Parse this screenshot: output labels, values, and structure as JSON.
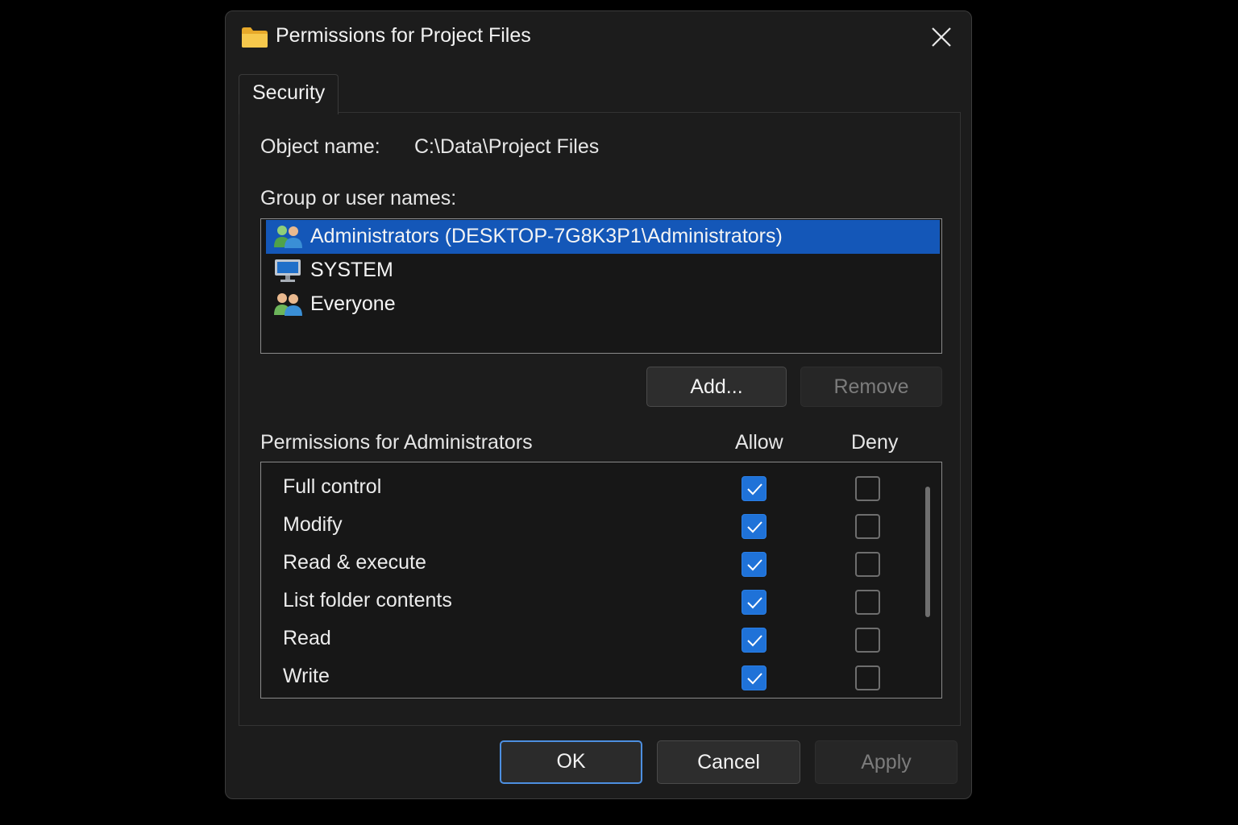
{
  "dialog": {
    "title": "Permissions for Project Files",
    "tab_security": "Security"
  },
  "security": {
    "object_name_label": "Object name:",
    "object_name_value": "C:\\Data\\Project Files",
    "group_label": "Group or user names:",
    "users": [
      {
        "label": "Administrators (DESKTOP-7G8K3P1\\Administrators)",
        "icon": "users-icon",
        "selected": true
      },
      {
        "label": "SYSTEM",
        "icon": "computer-icon",
        "selected": false
      },
      {
        "label": "Everyone",
        "icon": "users-icon",
        "selected": false
      }
    ],
    "add_button": "Add...",
    "remove_button": "Remove",
    "permissions_label": "Permissions for Administrators",
    "allow_header": "Allow",
    "deny_header": "Deny",
    "permissions": [
      {
        "name": "Full control",
        "allow": true,
        "deny": false
      },
      {
        "name": "Modify",
        "allow": true,
        "deny": false
      },
      {
        "name": "Read & execute",
        "allow": true,
        "deny": false
      },
      {
        "name": "List folder contents",
        "allow": true,
        "deny": false
      },
      {
        "name": "Read",
        "allow": true,
        "deny": false
      },
      {
        "name": "Write",
        "allow": true,
        "deny": false
      }
    ]
  },
  "footer": {
    "ok_button": "OK",
    "cancel_button": "Cancel",
    "apply_button": "Apply"
  },
  "colors": {
    "accent": "#1f72d8",
    "selection": "#1457b8",
    "background": "#1c1c1c"
  }
}
